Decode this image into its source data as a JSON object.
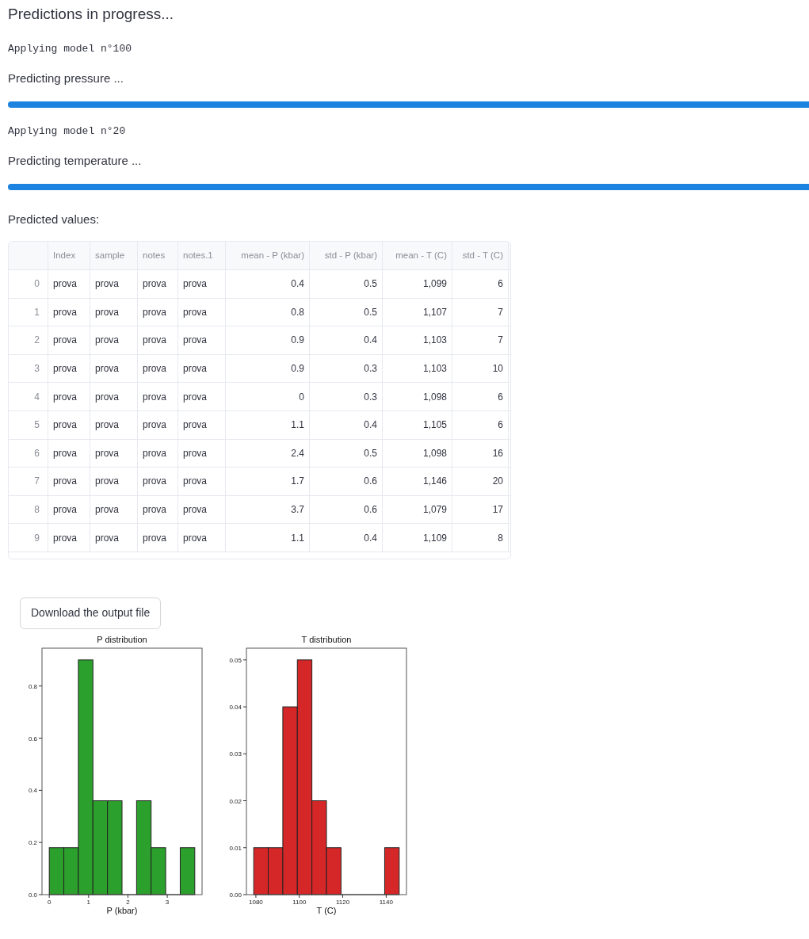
{
  "heading": "Predictions in progress...",
  "steps": [
    {
      "model": "Applying model n°100",
      "task": "Predicting pressure ...",
      "level": 1
    },
    {
      "model": "Applying model n°20",
      "task": "Predicting temperature ...",
      "level": 1
    }
  ],
  "result_label": "Predicted values:",
  "table": {
    "columns": [
      "",
      "Index",
      "sample",
      "notes",
      "notes.1",
      "mean - P (kbar)",
      "std - P (kbar)",
      "mean - T (C)",
      "std - T (C)"
    ],
    "rows": [
      [
        "0",
        "prova",
        "prova",
        "prova",
        "prova",
        "0.4",
        "0.5",
        "1,099",
        "6"
      ],
      [
        "1",
        "prova",
        "prova",
        "prova",
        "prova",
        "0.8",
        "0.5",
        "1,107",
        "7"
      ],
      [
        "2",
        "prova",
        "prova",
        "prova",
        "prova",
        "0.9",
        "0.4",
        "1,103",
        "7"
      ],
      [
        "3",
        "prova",
        "prova",
        "prova",
        "prova",
        "0.9",
        "0.3",
        "1,103",
        "10"
      ],
      [
        "4",
        "prova",
        "prova",
        "prova",
        "prova",
        "0",
        "0.3",
        "1,098",
        "6"
      ],
      [
        "5",
        "prova",
        "prova",
        "prova",
        "prova",
        "1.1",
        "0.4",
        "1,105",
        "6"
      ],
      [
        "6",
        "prova",
        "prova",
        "prova",
        "prova",
        "2.4",
        "0.5",
        "1,098",
        "16"
      ],
      [
        "7",
        "prova",
        "prova",
        "prova",
        "prova",
        "1.7",
        "0.6",
        "1,146",
        "20"
      ],
      [
        "8",
        "prova",
        "prova",
        "prova",
        "prova",
        "3.7",
        "0.6",
        "1,079",
        "17"
      ],
      [
        "9",
        "prova",
        "prova",
        "prova",
        "prova",
        "1.1",
        "0.4",
        "1,109",
        "8"
      ]
    ]
  },
  "download_button": "Download the output file",
  "charts": [
    {
      "chart_data": {
        "type": "bar",
        "title": "P distribution",
        "xlabel": "P (kbar)",
        "x": [
          0.185,
          0.555,
          0.925,
          1.295,
          1.665,
          2.035,
          2.405,
          2.775,
          3.145,
          3.515
        ],
        "series": [
          {
            "color": "#2ca02c",
            "values": [
              0.18,
              0.18,
              0.9,
              0.36,
              0.36,
              0,
              0.36,
              0.18,
              0,
              0.18
            ]
          }
        ],
        "xlim": [
          -0.185,
          3.885
        ],
        "ylim": [
          0,
          0.945
        ],
        "xticks": [
          0,
          1,
          2,
          3
        ],
        "yticks": [
          {
            "value": 0,
            "label": "0.0"
          },
          {
            "value": 0.2,
            "label": "0.2"
          },
          {
            "value": 0.4,
            "label": "0.4"
          },
          {
            "value": 0.6,
            "label": "0.6"
          },
          {
            "value": 0.8,
            "label": "0.8"
          }
        ]
      }
    },
    {
      "chart_data": {
        "type": "bar",
        "title": "T distribution",
        "xlabel": "T (C)",
        "x": [
          1082.35,
          1089.05,
          1095.75,
          1102.45,
          1109.15,
          1115.85,
          1122.55,
          1129.25,
          1135.95,
          1142.65
        ],
        "series": [
          {
            "color": "#d62728",
            "values": [
              0.01,
              0.01,
              0.04,
              0.05,
              0.02,
              0.01,
              0,
              0,
              0,
              0.01
            ]
          }
        ],
        "xlim": [
          1075.65,
          1149.35
        ],
        "ylim": [
          0,
          0.0525
        ],
        "xticks": [
          1080,
          1100,
          1120,
          1140
        ],
        "yticks": [
          {
            "value": 0,
            "label": "0.00"
          },
          {
            "value": 0.01,
            "label": "0.01"
          },
          {
            "value": 0.02,
            "label": "0.02"
          },
          {
            "value": 0.03,
            "label": "0.03"
          },
          {
            "value": 0.04,
            "label": "0.04"
          },
          {
            "value": 0.05,
            "label": "0.05"
          }
        ]
      }
    }
  ]
}
